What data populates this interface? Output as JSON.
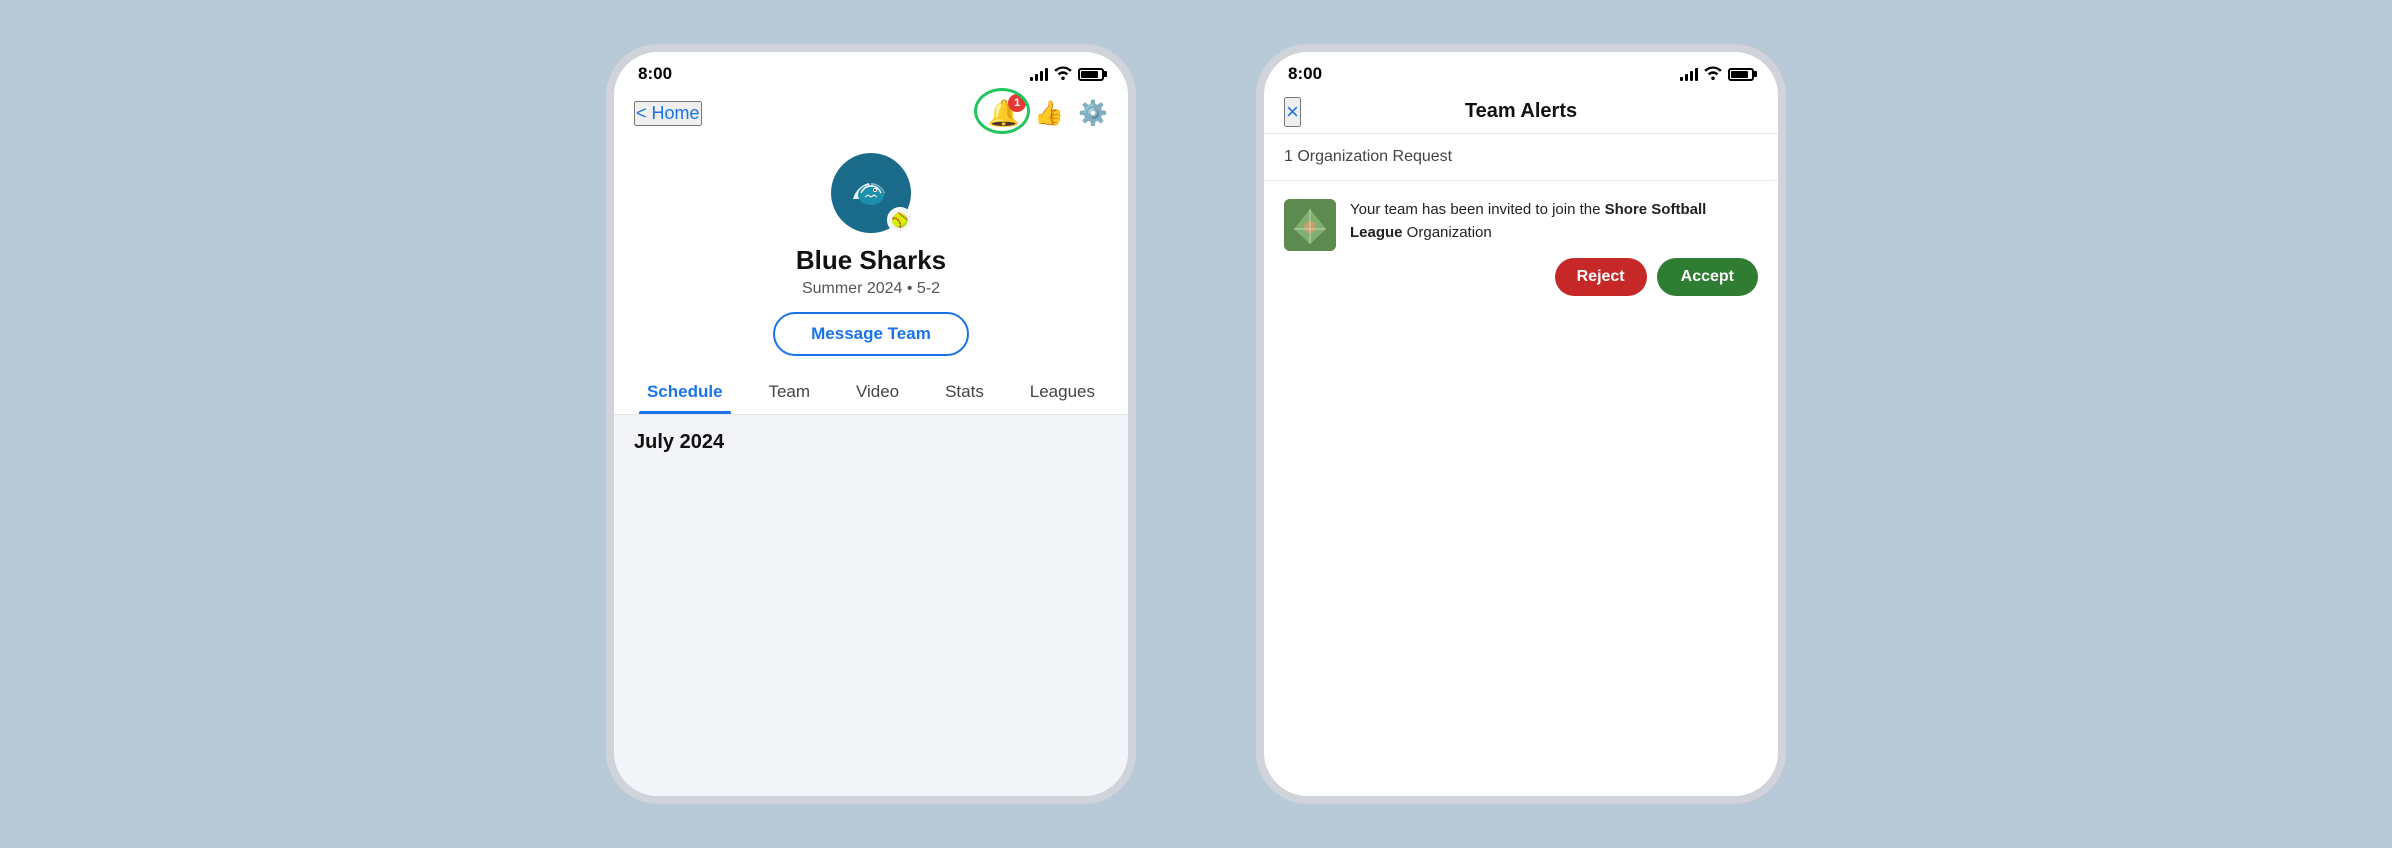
{
  "phone1": {
    "status": {
      "time": "8:00"
    },
    "nav": {
      "back_label": "< Home",
      "notification_badge": "1"
    },
    "team": {
      "name": "Blue Sharks",
      "season": "Summer 2024",
      "record": "5-2",
      "meta": "Summer 2024 • 5-2",
      "message_btn": "Message Team"
    },
    "tabs": [
      {
        "label": "Schedule",
        "active": true
      },
      {
        "label": "Team",
        "active": false
      },
      {
        "label": "Video",
        "active": false
      },
      {
        "label": "Stats",
        "active": false
      },
      {
        "label": "Leagues",
        "active": false
      }
    ],
    "schedule_header": "July 2024"
  },
  "phone2": {
    "status": {
      "time": "8:00"
    },
    "nav": {
      "title": "Team Alerts",
      "close_icon": "×"
    },
    "org_request": {
      "header": "1 Organization Request",
      "message_prefix": "Your team has been invited to join the ",
      "org_name": "Shore Softball League",
      "message_suffix": " Organization",
      "reject_btn": "Reject",
      "accept_btn": "Accept"
    }
  }
}
